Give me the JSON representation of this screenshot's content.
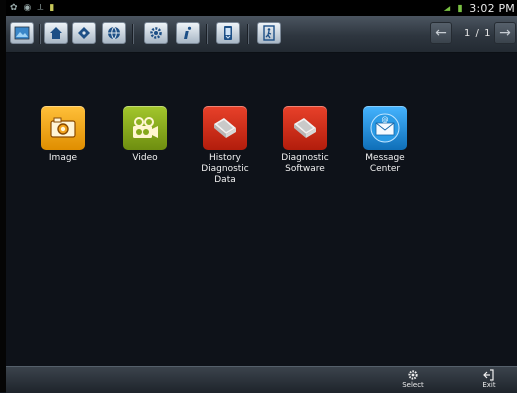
{
  "status": {
    "time": "3:02 PM"
  },
  "toolbar": {
    "page_info": "1 / 1"
  },
  "apps": [
    {
      "label": "Image",
      "color": "#f0a50c"
    },
    {
      "label": "Video",
      "color": "#86a91a"
    },
    {
      "label": "History Diagnostic Data",
      "line1": "History",
      "line2": "Diagnostic Data",
      "color": "#c92a14"
    },
    {
      "label": "Diagnostic Software",
      "line1": "Diagnostic",
      "line2": "Software",
      "color": "#c92a14"
    },
    {
      "label": "Message Center",
      "color": "#1d8fd6"
    }
  ],
  "bottom": {
    "select_label": "Select",
    "exit_label": "Exit"
  }
}
